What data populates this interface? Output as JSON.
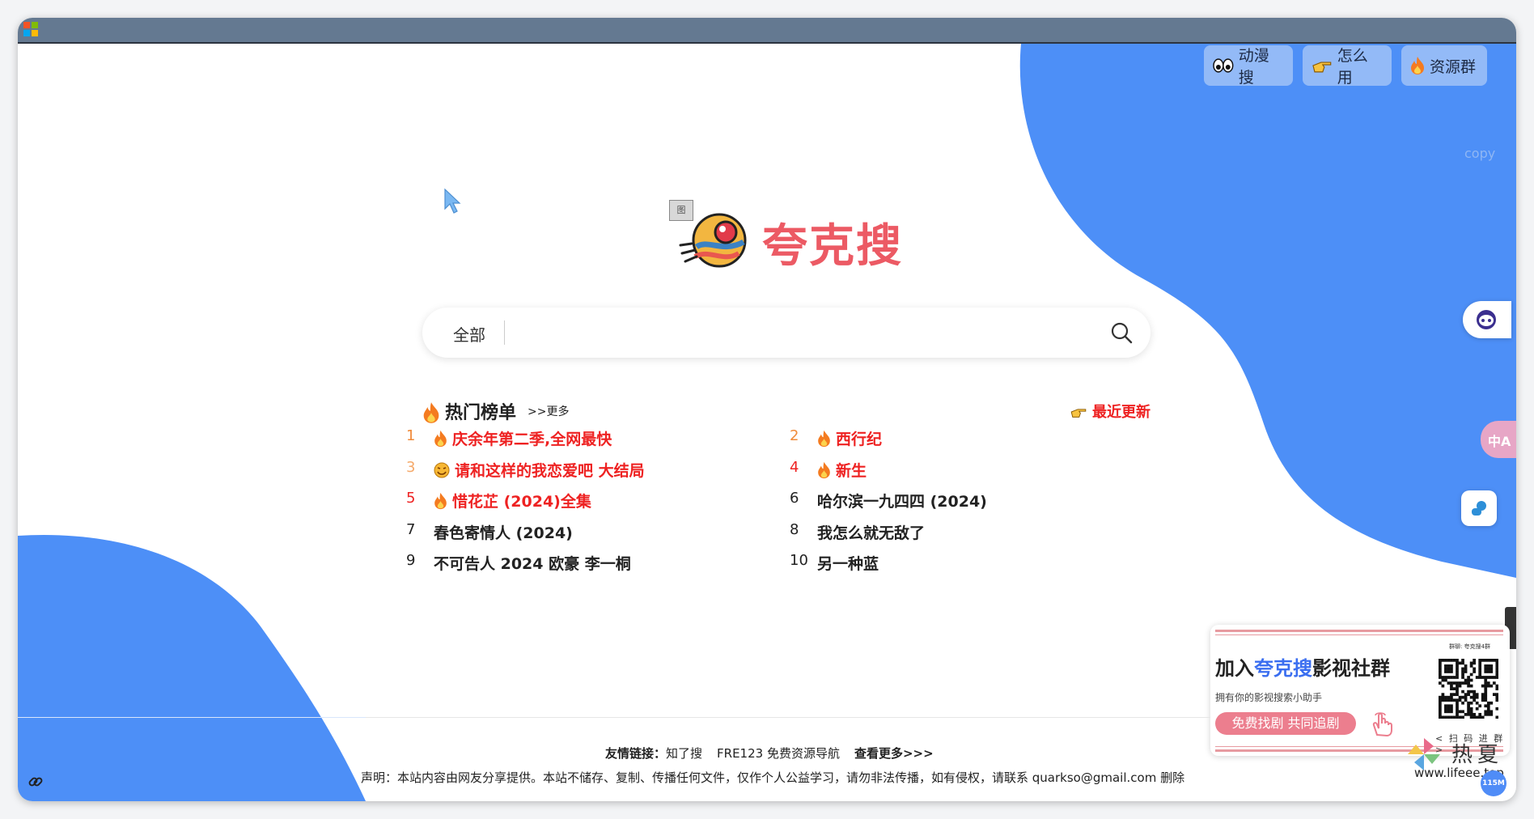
{
  "top_buttons": [
    {
      "label": "动漫搜",
      "icon": "eyes-icon"
    },
    {
      "label": "怎么用",
      "icon": "pointing-hand-icon"
    },
    {
      "label": "资源群",
      "icon": "fire-icon"
    }
  ],
  "ghost_copy": "copy",
  "broken_image_label": "图",
  "site_title": "夸克搜",
  "search": {
    "scope": "全部",
    "value": ""
  },
  "hot": {
    "title": "热门榜单",
    "more": ">>更多",
    "recent_label": "最近更新",
    "items": [
      {
        "rank": "1",
        "text": "庆余年第二季,全网最快",
        "icon": "fire-icon",
        "hot": true
      },
      {
        "rank": "2",
        "text": "西行纪",
        "icon": "fire-icon",
        "hot": true
      },
      {
        "rank": "3",
        "text": "请和这样的我恋爱吧 大结局",
        "icon": "smile-icon",
        "hot": true
      },
      {
        "rank": "4",
        "text": "新生",
        "icon": "fire-icon",
        "hot": true
      },
      {
        "rank": "5",
        "text": "惜花芷 (2024)全集",
        "icon": "fire-icon",
        "hot": true
      },
      {
        "rank": "6",
        "text": "哈尔滨一九四四 (2024)",
        "icon": "",
        "hot": false
      },
      {
        "rank": "7",
        "text": "春色寄情人 (2024)",
        "icon": "",
        "hot": false
      },
      {
        "rank": "8",
        "text": "我怎么就无敌了",
        "icon": "",
        "hot": false
      },
      {
        "rank": "9",
        "text": "不可告人 2024 欧豪 李一桐",
        "icon": "",
        "hot": false
      },
      {
        "rank": "10",
        "text": "另一种蓝",
        "icon": "",
        "hot": false
      }
    ]
  },
  "side_float": {
    "translate_label": "中A"
  },
  "ad": {
    "title_prefix": "加入",
    "title_highlight": "夸克搜",
    "title_suffix": "影视社群",
    "subtitle": "拥有你的影视搜索小助手",
    "button": "免费找剧 共同追剧",
    "qr_label": "< 扫 码 进 群 >",
    "qr_top": "群聊: 夸克搜4群"
  },
  "footer": {
    "links_label": "友情链接：",
    "links": [
      "知了搜",
      "FRE123 免费资源导航"
    ],
    "more": "查看更多>>>",
    "declaration": "声明：本站内容由网友分享提供。本站不储存、复制、传播任何文件，仅作个人公益学习，请勿非法传播，如有侵权，请联系 quarkso@gmail.com 删除"
  },
  "watermark": {
    "cn": "热夏",
    "url": "www.lifeee.top",
    "badge": "115M"
  },
  "colors": {
    "blob_blue": "#4d8ff7",
    "titlebar": "#647991",
    "accent_red": "#ee2222",
    "rank_orange": "#f08b3a"
  }
}
